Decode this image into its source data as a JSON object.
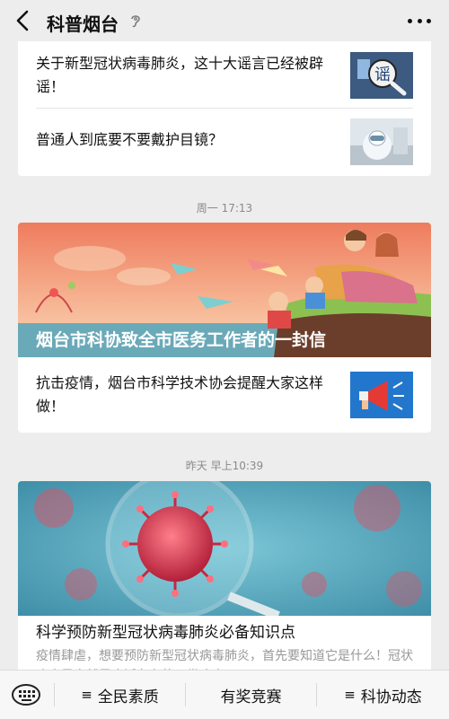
{
  "header": {
    "title": "科普烟台"
  },
  "card1": {
    "item1": "关于新型冠状病毒肺炎，这十大谣言已经被辟谣！",
    "thumb1_text": "谣",
    "item2": "普通人到底要不要戴护目镜？"
  },
  "time1": "周一 17:13",
  "card2": {
    "hero_title": "烟台市科协致全市医务工作者的一封信",
    "item1": "抗击疫情，烟台市科学技术协会提醒大家这样做！"
  },
  "time2": "昨天 早上10:39",
  "card3": {
    "title": "科学预防新型冠状病毒肺炎必备知识点",
    "desc": "疫情肆虐，想要预防新型冠状病毒肺炎，首先要知道它是什么！冠状病毒是自然界广泛存在的一类病毒"
  },
  "bottom_menu": {
    "item1": "全民素质",
    "item2": "有奖竞赛",
    "item3": "科协动态"
  },
  "colors": {
    "accent": "#2f6fd0",
    "background": "#ededed"
  }
}
